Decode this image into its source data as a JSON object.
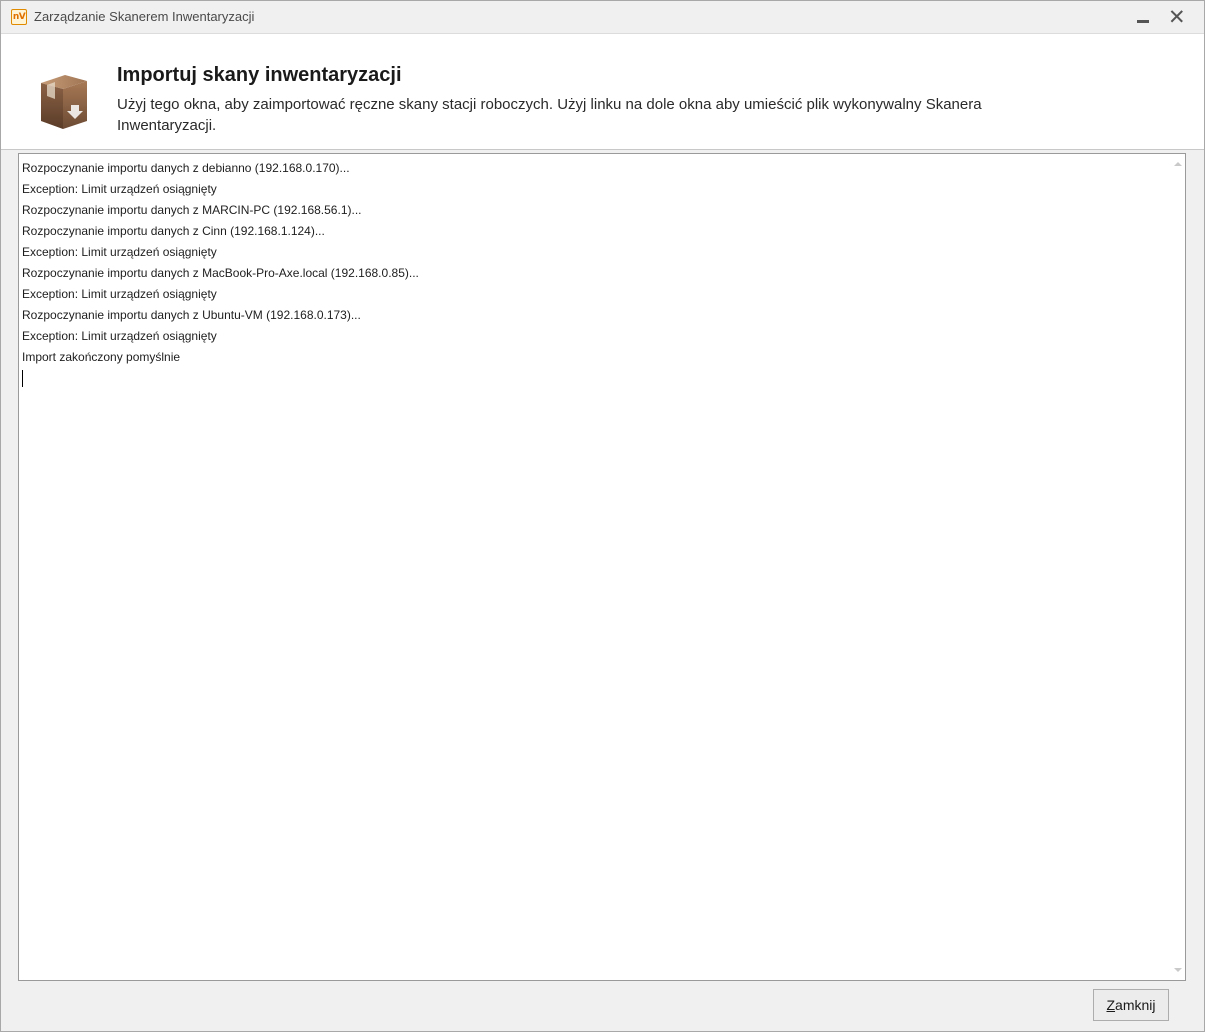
{
  "window": {
    "title": "Zarządzanie Skanerem Inwentaryzacji",
    "app_icon_text": "nV",
    "minimize_icon": "minimize-icon",
    "close_icon": "close-icon"
  },
  "header": {
    "title": "Importuj skany inwentaryzacji",
    "description": "Użyj tego okna, aby zaimportować ręczne skany stacji roboczych. Użyj linku na dole okna aby umieścić plik wykonywalny Skanera Inwentaryzacji.",
    "icon": "package-download-icon"
  },
  "log": {
    "lines": [
      "Rozpoczynanie importu danych z debianno (192.168.0.170)...",
      "Exception: Limit urządzeń osiągnięty",
      "Rozpoczynanie importu danych z MARCIN-PC (192.168.56.1)...",
      "Rozpoczynanie importu danych z Cinn (192.168.1.124)...",
      "Exception: Limit urządzeń osiągnięty",
      "Rozpoczynanie importu danych z MacBook-Pro-Axe.local (192.168.0.85)...",
      "Exception: Limit urządzeń osiągnięty",
      "Rozpoczynanie importu danych z Ubuntu-VM (192.168.0.173)...",
      "Exception: Limit urządzeń osiągnięty",
      "Import zakończony pomyślnie"
    ]
  },
  "footer": {
    "close_label_first": "Z",
    "close_label_rest": "amknij"
  },
  "colors": {
    "accent": "#e07000",
    "window_bg": "#f0f0f0",
    "border": "#9a9a9a"
  }
}
